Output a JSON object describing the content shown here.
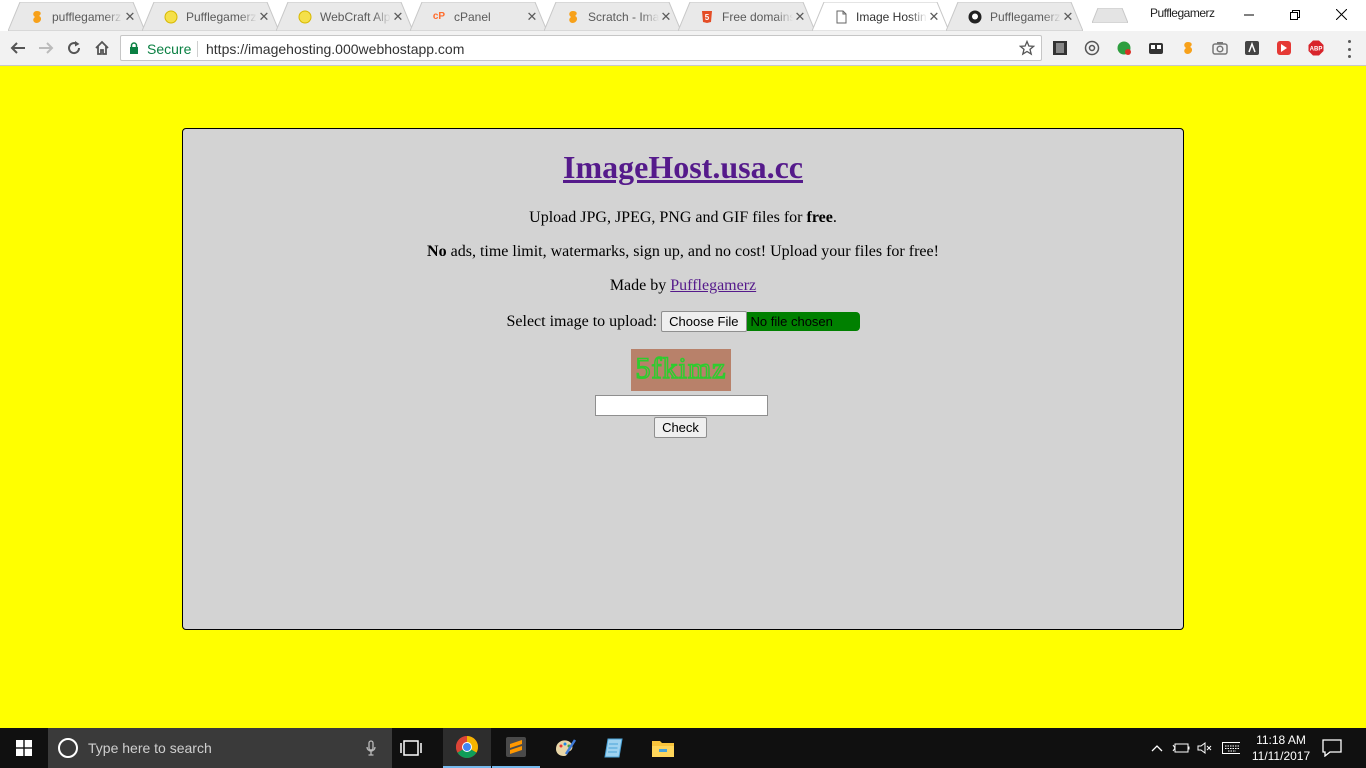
{
  "browser": {
    "tabs": [
      {
        "title": "pufflegamerz",
        "favicon": "scratch-icon",
        "active": false
      },
      {
        "title": "Pufflegamerz",
        "favicon": "smiley-icon",
        "active": false
      },
      {
        "title": "WebCraft Alpha",
        "favicon": "smiley-icon",
        "active": false
      },
      {
        "title": "cPanel",
        "favicon": "cpanel-icon",
        "active": false
      },
      {
        "title": "Scratch - Imagine",
        "favicon": "scratch-icon",
        "active": false
      },
      {
        "title": "Free domains",
        "favicon": "html5-icon",
        "active": false
      },
      {
        "title": "Image Hosting",
        "favicon": "page-icon",
        "active": true
      },
      {
        "title": "Pufflegamerz",
        "favicon": "github-icon",
        "active": false
      }
    ],
    "profile_name": "Pufflegamerz",
    "security_label": "Secure",
    "url": "https://imagehosting.000webhostapp.com"
  },
  "page": {
    "background_color": "#ffff00",
    "site_title": "ImageHost.usa.cc",
    "upload_desc_prefix": "Upload JPG, JPEG, PNG and GIF files for ",
    "upload_desc_bold": "free",
    "upload_desc_suffix": ".",
    "no_ads_bold": "No",
    "no_ads_rest": " ads, time limit, watermarks, sign up, and no cost! Upload your files for free!",
    "made_by_prefix": "Made by ",
    "made_by_link": "Pufflegamerz",
    "select_label": "Select image to upload:",
    "choose_file_label": "Choose File",
    "no_file_label": "No file chosen",
    "captcha_text": "5fkimz",
    "captcha_input_value": "",
    "check_label": "Check"
  },
  "taskbar": {
    "search_placeholder": "Type here to search",
    "apps": [
      "chrome-icon",
      "sublime-text-icon",
      "paint-icon",
      "notepad-icon",
      "file-explorer-icon"
    ],
    "time": "11:18 AM",
    "date": "11/11/2017"
  }
}
